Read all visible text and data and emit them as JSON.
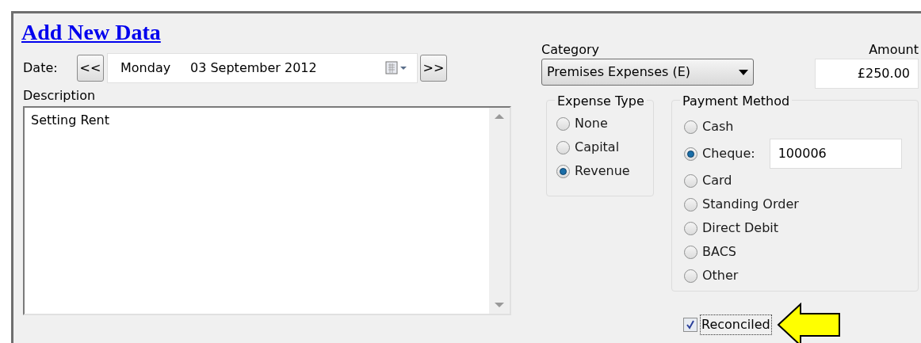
{
  "title": "Add New Data",
  "date": {
    "label": "Date:",
    "prev": "<<",
    "next": ">>",
    "weekday": "Monday",
    "value": "03 September 2012"
  },
  "description": {
    "label": "Description",
    "value": "Setting Rent"
  },
  "category": {
    "label": "Category",
    "value": "Premises Expenses (E)"
  },
  "amount": {
    "label": "Amount",
    "value": "£250.00"
  },
  "expense_type": {
    "label": "Expense Type",
    "options": [
      {
        "label": "None",
        "selected": false
      },
      {
        "label": "Capital",
        "selected": false
      },
      {
        "label": "Revenue",
        "selected": true
      }
    ]
  },
  "payment_method": {
    "label": "Payment Method",
    "options": [
      {
        "label": "Cash",
        "selected": false
      },
      {
        "label": "Cheque:",
        "selected": true,
        "field": "100006"
      },
      {
        "label": "Card",
        "selected": false
      },
      {
        "label": "Standing Order",
        "selected": false
      },
      {
        "label": "Direct Debit",
        "selected": false
      },
      {
        "label": "BACS",
        "selected": false
      },
      {
        "label": "Other",
        "selected": false
      }
    ]
  },
  "reconciled": {
    "label": "Reconciled",
    "checked": true
  }
}
